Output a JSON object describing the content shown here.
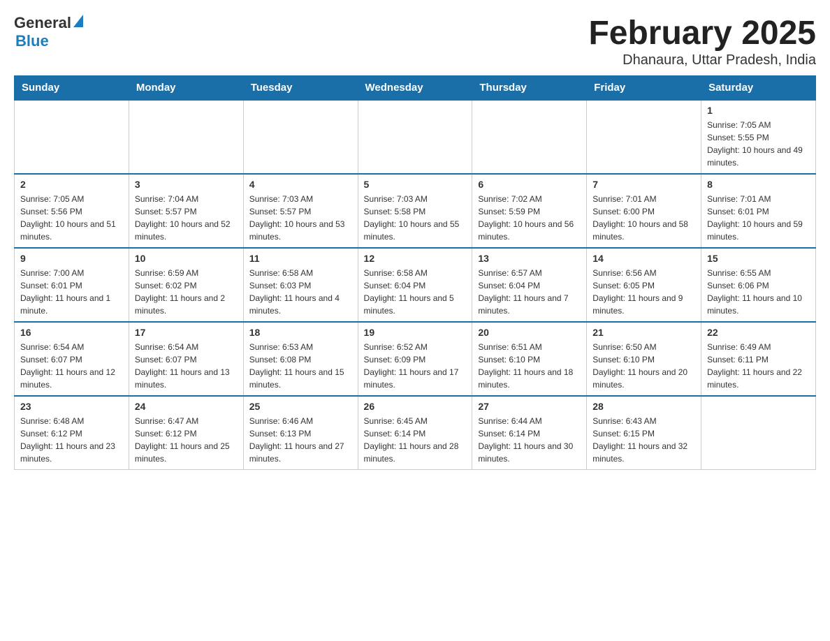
{
  "header": {
    "title": "February 2025",
    "subtitle": "Dhanaura, Uttar Pradesh, India",
    "logo_general": "General",
    "logo_blue": "Blue"
  },
  "weekdays": [
    "Sunday",
    "Monday",
    "Tuesday",
    "Wednesday",
    "Thursday",
    "Friday",
    "Saturday"
  ],
  "weeks": [
    [
      {
        "day": "",
        "sunrise": "",
        "sunset": "",
        "daylight": ""
      },
      {
        "day": "",
        "sunrise": "",
        "sunset": "",
        "daylight": ""
      },
      {
        "day": "",
        "sunrise": "",
        "sunset": "",
        "daylight": ""
      },
      {
        "day": "",
        "sunrise": "",
        "sunset": "",
        "daylight": ""
      },
      {
        "day": "",
        "sunrise": "",
        "sunset": "",
        "daylight": ""
      },
      {
        "day": "",
        "sunrise": "",
        "sunset": "",
        "daylight": ""
      },
      {
        "day": "1",
        "sunrise": "Sunrise: 7:05 AM",
        "sunset": "Sunset: 5:55 PM",
        "daylight": "Daylight: 10 hours and 49 minutes."
      }
    ],
    [
      {
        "day": "2",
        "sunrise": "Sunrise: 7:05 AM",
        "sunset": "Sunset: 5:56 PM",
        "daylight": "Daylight: 10 hours and 51 minutes."
      },
      {
        "day": "3",
        "sunrise": "Sunrise: 7:04 AM",
        "sunset": "Sunset: 5:57 PM",
        "daylight": "Daylight: 10 hours and 52 minutes."
      },
      {
        "day": "4",
        "sunrise": "Sunrise: 7:03 AM",
        "sunset": "Sunset: 5:57 PM",
        "daylight": "Daylight: 10 hours and 53 minutes."
      },
      {
        "day": "5",
        "sunrise": "Sunrise: 7:03 AM",
        "sunset": "Sunset: 5:58 PM",
        "daylight": "Daylight: 10 hours and 55 minutes."
      },
      {
        "day": "6",
        "sunrise": "Sunrise: 7:02 AM",
        "sunset": "Sunset: 5:59 PM",
        "daylight": "Daylight: 10 hours and 56 minutes."
      },
      {
        "day": "7",
        "sunrise": "Sunrise: 7:01 AM",
        "sunset": "Sunset: 6:00 PM",
        "daylight": "Daylight: 10 hours and 58 minutes."
      },
      {
        "day": "8",
        "sunrise": "Sunrise: 7:01 AM",
        "sunset": "Sunset: 6:01 PM",
        "daylight": "Daylight: 10 hours and 59 minutes."
      }
    ],
    [
      {
        "day": "9",
        "sunrise": "Sunrise: 7:00 AM",
        "sunset": "Sunset: 6:01 PM",
        "daylight": "Daylight: 11 hours and 1 minute."
      },
      {
        "day": "10",
        "sunrise": "Sunrise: 6:59 AM",
        "sunset": "Sunset: 6:02 PM",
        "daylight": "Daylight: 11 hours and 2 minutes."
      },
      {
        "day": "11",
        "sunrise": "Sunrise: 6:58 AM",
        "sunset": "Sunset: 6:03 PM",
        "daylight": "Daylight: 11 hours and 4 minutes."
      },
      {
        "day": "12",
        "sunrise": "Sunrise: 6:58 AM",
        "sunset": "Sunset: 6:04 PM",
        "daylight": "Daylight: 11 hours and 5 minutes."
      },
      {
        "day": "13",
        "sunrise": "Sunrise: 6:57 AM",
        "sunset": "Sunset: 6:04 PM",
        "daylight": "Daylight: 11 hours and 7 minutes."
      },
      {
        "day": "14",
        "sunrise": "Sunrise: 6:56 AM",
        "sunset": "Sunset: 6:05 PM",
        "daylight": "Daylight: 11 hours and 9 minutes."
      },
      {
        "day": "15",
        "sunrise": "Sunrise: 6:55 AM",
        "sunset": "Sunset: 6:06 PM",
        "daylight": "Daylight: 11 hours and 10 minutes."
      }
    ],
    [
      {
        "day": "16",
        "sunrise": "Sunrise: 6:54 AM",
        "sunset": "Sunset: 6:07 PM",
        "daylight": "Daylight: 11 hours and 12 minutes."
      },
      {
        "day": "17",
        "sunrise": "Sunrise: 6:54 AM",
        "sunset": "Sunset: 6:07 PM",
        "daylight": "Daylight: 11 hours and 13 minutes."
      },
      {
        "day": "18",
        "sunrise": "Sunrise: 6:53 AM",
        "sunset": "Sunset: 6:08 PM",
        "daylight": "Daylight: 11 hours and 15 minutes."
      },
      {
        "day": "19",
        "sunrise": "Sunrise: 6:52 AM",
        "sunset": "Sunset: 6:09 PM",
        "daylight": "Daylight: 11 hours and 17 minutes."
      },
      {
        "day": "20",
        "sunrise": "Sunrise: 6:51 AM",
        "sunset": "Sunset: 6:10 PM",
        "daylight": "Daylight: 11 hours and 18 minutes."
      },
      {
        "day": "21",
        "sunrise": "Sunrise: 6:50 AM",
        "sunset": "Sunset: 6:10 PM",
        "daylight": "Daylight: 11 hours and 20 minutes."
      },
      {
        "day": "22",
        "sunrise": "Sunrise: 6:49 AM",
        "sunset": "Sunset: 6:11 PM",
        "daylight": "Daylight: 11 hours and 22 minutes."
      }
    ],
    [
      {
        "day": "23",
        "sunrise": "Sunrise: 6:48 AM",
        "sunset": "Sunset: 6:12 PM",
        "daylight": "Daylight: 11 hours and 23 minutes."
      },
      {
        "day": "24",
        "sunrise": "Sunrise: 6:47 AM",
        "sunset": "Sunset: 6:12 PM",
        "daylight": "Daylight: 11 hours and 25 minutes."
      },
      {
        "day": "25",
        "sunrise": "Sunrise: 6:46 AM",
        "sunset": "Sunset: 6:13 PM",
        "daylight": "Daylight: 11 hours and 27 minutes."
      },
      {
        "day": "26",
        "sunrise": "Sunrise: 6:45 AM",
        "sunset": "Sunset: 6:14 PM",
        "daylight": "Daylight: 11 hours and 28 minutes."
      },
      {
        "day": "27",
        "sunrise": "Sunrise: 6:44 AM",
        "sunset": "Sunset: 6:14 PM",
        "daylight": "Daylight: 11 hours and 30 minutes."
      },
      {
        "day": "28",
        "sunrise": "Sunrise: 6:43 AM",
        "sunset": "Sunset: 6:15 PM",
        "daylight": "Daylight: 11 hours and 32 minutes."
      },
      {
        "day": "",
        "sunrise": "",
        "sunset": "",
        "daylight": ""
      }
    ]
  ]
}
